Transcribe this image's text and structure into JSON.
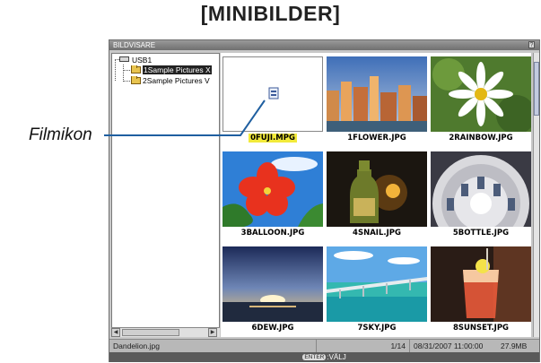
{
  "heading": "[MINIBILDER]",
  "callout": {
    "label": "Filmikon"
  },
  "window": {
    "title": "BILDVISARE",
    "help_glyph": "?"
  },
  "tree": {
    "drive": "USB1",
    "folders": [
      {
        "label": "1Sample Pictures X",
        "selected": true
      },
      {
        "label": "2Sample Pictures V",
        "selected": false
      }
    ]
  },
  "thumbnails": [
    {
      "name": "0FUJI.MPG",
      "kind": "movie",
      "selected": true
    },
    {
      "name": "1FLOWER.JPG",
      "kind": "city"
    },
    {
      "name": "2RAINBOW.JPG",
      "kind": "flower"
    },
    {
      "name": "3BALLOON.JPG",
      "kind": "hibiscus"
    },
    {
      "name": "4SNAIL.JPG",
      "kind": "bottle"
    },
    {
      "name": "5BOTTLE.JPG",
      "kind": "dome"
    },
    {
      "name": "6DEW.JPG",
      "kind": "sunset"
    },
    {
      "name": "7SKY.JPG",
      "kind": "bridge"
    },
    {
      "name": "8SUNSET.JPG",
      "kind": "drink"
    }
  ],
  "status": {
    "filename": "Dandelion.jpg",
    "position": "1/14",
    "datetime": "08/31/2007 11:00:00",
    "size": "27.9MB"
  },
  "footer": {
    "key": "ENTER",
    "action": ":VÄLJ"
  }
}
